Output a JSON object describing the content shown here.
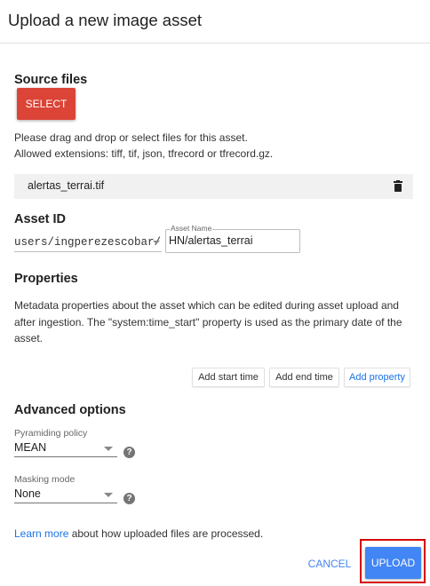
{
  "dialog": {
    "title": "Upload a new image asset"
  },
  "source_files": {
    "heading": "Source files",
    "select_label": "SELECT",
    "help_line1": "Please drag and drop or select files for this asset.",
    "help_line2": "Allowed extensions: tiff, tif, json, tfrecord or tfrecord.gz.",
    "file_name": "alertas_terrai.tif",
    "delete_icon": "trash-icon"
  },
  "asset_id": {
    "heading": "Asset ID",
    "prefix_value": "users/ingperezescobar/",
    "name_label": "Asset Name",
    "name_value": "HN/alertas_terrai"
  },
  "properties": {
    "heading": "Properties",
    "description": "Metadata properties about the asset which can be edited during asset upload and after ingestion. The \"system:time_start\" property is used as the primary date of the asset.",
    "add_start_time": "Add start time",
    "add_end_time": "Add end time",
    "add_property": "Add property"
  },
  "advanced": {
    "heading": "Advanced options",
    "pyramiding_label": "Pyramiding policy",
    "pyramiding_value": "MEAN",
    "masking_label": "Masking mode",
    "masking_value": "None",
    "help_glyph": "?"
  },
  "footer": {
    "learn_more": "Learn more",
    "learn_rest": " about how uploaded files are processed.",
    "cancel": "CANCEL",
    "upload": "UPLOAD"
  },
  "colors": {
    "select_button": "#db4437",
    "upload_button": "#4285f4",
    "link": "#1a73e8",
    "highlight": "#d50000"
  }
}
